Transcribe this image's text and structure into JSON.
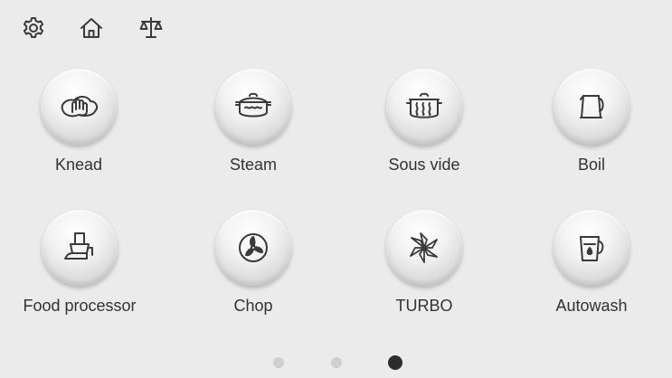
{
  "top_icons": [
    "gear-icon",
    "home-icon",
    "scale-icon"
  ],
  "modes": [
    {
      "label": "Knead",
      "icon": "knead-icon"
    },
    {
      "label": "Steam",
      "icon": "steam-icon"
    },
    {
      "label": "Sous vide",
      "icon": "sous-vide-icon"
    },
    {
      "label": "Boil",
      "icon": "kettle-icon"
    },
    {
      "label": "Food processor",
      "icon": "food-processor-icon"
    },
    {
      "label": "Chop",
      "icon": "chop-icon"
    },
    {
      "label": "TURBO",
      "icon": "turbo-icon"
    },
    {
      "label": "Autowash",
      "icon": "autowash-icon"
    }
  ],
  "pager": {
    "pages": 3,
    "active_index": 2
  },
  "colors": {
    "background": "#ebebeb",
    "icon_stroke": "#3a3a3a",
    "dot_inactive": "#cfcfcf",
    "dot_active": "#2d2d2d"
  }
}
